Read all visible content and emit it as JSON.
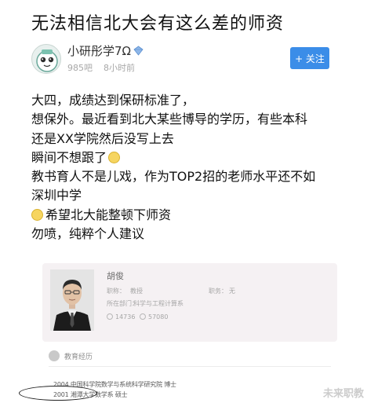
{
  "page": {
    "title": "无法相信北大会有这么差的师资"
  },
  "author": {
    "name": "小研彤学7Ω",
    "meta_left": "985吧",
    "meta_right": "8小时前",
    "follow_label": "+ 关注",
    "verify_icon": "verified-diamond-icon"
  },
  "post": {
    "lines": [
      "大四，成绩达到保研标准了，",
      "想保外。最近看到北大某些博导的学历，有些本科",
      "还是XX学院然后没写上去",
      "瞬间不想跟了",
      "教书育人不是儿戏，作为TOP2招的老师水平还不如",
      "深圳中学",
      "希望北大能整顿下师资",
      "勿喷，纯粹个人建议"
    ],
    "emoji_smile": "smile-emoji-icon",
    "emoji_sad": "sad-emoji-icon"
  },
  "profile": {
    "name": "胡俊",
    "title_label": "职称：",
    "title_value": "教授",
    "post_label": "职务：",
    "post_value": "无",
    "dept_label": "所在部门：",
    "dept_value": "科学与工程计算系",
    "stat_1": "14736",
    "stat_2": "57080"
  },
  "education": {
    "section_title": "教育经历",
    "entries": [
      "2004 中国科学院数学与系统科学研究院 博士",
      "2001 湘潭大学数学系 硕士"
    ]
  },
  "watermark": "未来职教"
}
